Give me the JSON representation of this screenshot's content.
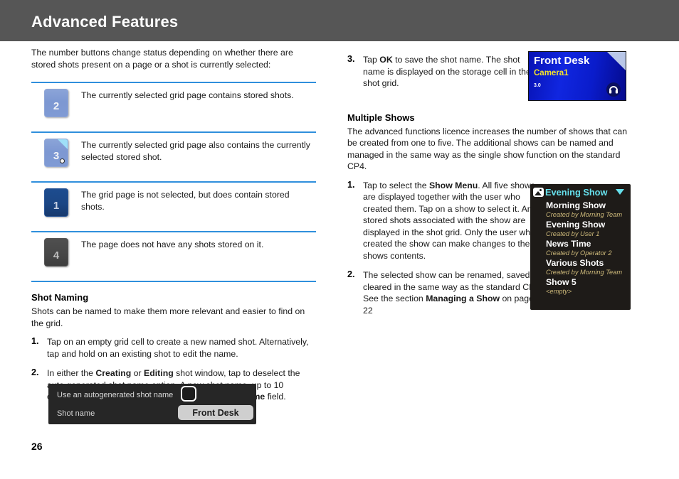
{
  "header": {
    "title": "Advanced Features"
  },
  "page_number": "26",
  "colors": {
    "header_bar": "#565656",
    "rule": "#2f8fdc",
    "accent_cyan": "#66e0ec",
    "created_by": "#cdb97a",
    "camera_yellow": "#f5e32a"
  },
  "left": {
    "intro": "The number buttons change status depending on whether there are stored shots present on a page or a shot is currently selected:",
    "status_rows": [
      {
        "number": "2",
        "style": "light",
        "corner": false,
        "dot": false,
        "description": "The currently selected grid page contains stored shots."
      },
      {
        "number": "3",
        "style": "light",
        "corner": true,
        "dot": true,
        "description": "The currently selected grid page also contains the currently selected stored shot."
      },
      {
        "number": "1",
        "style": "dark",
        "corner": false,
        "dot": false,
        "description": "The grid page is not selected, but does contain stored shots."
      },
      {
        "number": "4",
        "style": "grey",
        "corner": false,
        "dot": false,
        "description": "The page does not have any shots stored on it."
      }
    ],
    "shot_naming": {
      "heading": "Shot Naming",
      "intro": "Shots can be named to make them more relevant and easier to find on the grid.",
      "steps": [
        {
          "num": "1.",
          "text_parts": [
            {
              "t": "Tap on an empty grid cell to create a new named shot. Alternatively, tap and hold on an existing shot to edit the name.",
              "bold": false
            }
          ]
        },
        {
          "num": "2.",
          "text_parts": [
            {
              "t": "In either the ",
              "bold": false
            },
            {
              "t": "Creating",
              "bold": true
            },
            {
              "t": " or ",
              "bold": false
            },
            {
              "t": "Editing",
              "bold": true
            },
            {
              "t": " shot window, tap to deselect the auto generated shot name option. A new shot name, up to 10 characters in length, can be entered into the ",
              "bold": false
            },
            {
              "t": "Shot name",
              "bold": true
            },
            {
              "t": " field.",
              "bold": false
            }
          ]
        }
      ]
    },
    "shot_panel": {
      "autogenerate_label": "Use an autogenerated shot name",
      "autogenerate_checked": false,
      "shot_name_label": "Shot name",
      "shot_name_value": "Front Desk"
    }
  },
  "right": {
    "step3": {
      "num": "3.",
      "text_parts": [
        {
          "t": "Tap ",
          "bold": false
        },
        {
          "t": "OK",
          "bold": true
        },
        {
          "t": " to save the shot name. The shot name is displayed on the storage cell in the shot grid.",
          "bold": false
        }
      ]
    },
    "shot_cell": {
      "title": "Front Desk",
      "camera": "Camera1",
      "version": "3.0",
      "icon": "headphone-icon"
    },
    "multiple_shows": {
      "heading": "Multiple Shows",
      "intro": "The advanced functions licence increases the number of shows that can be created from one to five. The additional shows can be named and managed in the same way as the single show function on the standard CP4.",
      "steps": [
        {
          "num": "1.",
          "text_parts": [
            {
              "t": "Tap to select the ",
              "bold": false
            },
            {
              "t": "Show Menu",
              "bold": true
            },
            {
              "t": ". All five shows are displayed together with the user who created them. Tap on a show to select it. Any stored shots associated with the show are displayed in the shot grid. Only the user who created the show can make changes to the shows contents.",
              "bold": false
            }
          ]
        },
        {
          "num": "2.",
          "text_parts": [
            {
              "t": "The selected show can be renamed, saved or cleared in the same way as the standard CP4. See the section ",
              "bold": false
            },
            {
              "t": "Managing a Show",
              "bold": true
            },
            {
              "t": " on page 22",
              "bold": false
            }
          ]
        }
      ]
    },
    "show_menu": {
      "icon": "picture-icon",
      "selected": "Evening Show",
      "caret": "chevron-down-icon",
      "items": [
        {
          "name": "Morning Show",
          "by": "Created by Morning Team"
        },
        {
          "name": "Evening Show",
          "by": "Created by User 1"
        },
        {
          "name": "News Time",
          "by": "Created by Operator 2"
        },
        {
          "name": "Various Shots",
          "by": "Created by Morning Team"
        },
        {
          "name": "Show 5",
          "by": "<empty>"
        }
      ]
    }
  }
}
